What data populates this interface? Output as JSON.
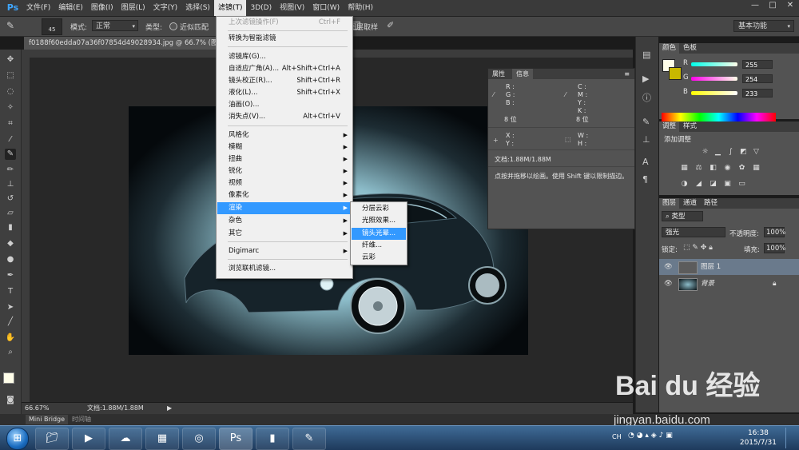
{
  "app": {
    "logo": "Ps",
    "menus": [
      "文件(F)",
      "编辑(E)",
      "图像(I)",
      "图层(L)",
      "文字(Y)",
      "选择(S)",
      "滤镜(T)",
      "3D(D)",
      "视图(V)",
      "窗口(W)",
      "帮助(H)"
    ],
    "active_menu": "滤镜(T)",
    "window_buttons": [
      "—",
      "□",
      "✕"
    ]
  },
  "options_bar": {
    "brush_size": "45",
    "mode_label": "模式:",
    "mode_value": "正常",
    "type_label": "类型:",
    "type_option": "近似匹配",
    "sample_label": "对所有图层取样",
    "workspace": "基本功能"
  },
  "document": {
    "tab_title": "f0188f60edda07a36f07854d49028934.jpg @ 66.7% (图层 1, RGB/8#) *",
    "zoom": "66.67%",
    "doc_size": "文档:1.88M/1.88M"
  },
  "filter_menu": {
    "items": [
      {
        "label": "上次滤镜操作(F)",
        "shortcut": "Ctrl+F",
        "disabled": true
      },
      {
        "label": "转换为智能滤镜"
      },
      {
        "label": "滤镜库(G)..."
      },
      {
        "label": "自适应广角(A)...",
        "shortcut": "Alt+Shift+Ctrl+A"
      },
      {
        "label": "镜头校正(R)...",
        "shortcut": "Shift+Ctrl+R"
      },
      {
        "label": "液化(L)...",
        "shortcut": "Shift+Ctrl+X"
      },
      {
        "label": "油画(O)..."
      },
      {
        "label": "消失点(V)...",
        "shortcut": "Alt+Ctrl+V"
      },
      {
        "label": "风格化",
        "submenu": true
      },
      {
        "label": "模糊",
        "submenu": true
      },
      {
        "label": "扭曲",
        "submenu": true
      },
      {
        "label": "锐化",
        "submenu": true
      },
      {
        "label": "视频",
        "submenu": true
      },
      {
        "label": "像素化",
        "submenu": true
      },
      {
        "label": "渲染",
        "submenu": true,
        "highlighted": true
      },
      {
        "label": "杂色",
        "submenu": true
      },
      {
        "label": "其它",
        "submenu": true
      },
      {
        "label": "Digimarc",
        "submenu": true
      },
      {
        "label": "浏览联机滤镜..."
      }
    ],
    "render_submenu": [
      "分层云彩",
      "光照效果...",
      "镜头光晕...",
      "纤维...",
      "云彩"
    ],
    "render_submenu_highlighted": "镜头光晕..."
  },
  "info_panel": {
    "tabs": [
      "属性",
      "信息"
    ],
    "active_tab": "信息",
    "rgb_labels": [
      "R :",
      "G :",
      "B :"
    ],
    "cmyk_labels": [
      "C :",
      "M :",
      "Y :",
      "K :"
    ],
    "bit_depth_left": "8 位",
    "bit_depth_right": "8 位",
    "xy_labels": [
      "X :",
      "Y :"
    ],
    "wh_labels": [
      "W :",
      "H :"
    ],
    "doc_line": "文档:1.88M/1.88M",
    "hint": "点按并拖移以绘画。使用 Shift 键以限制描边。"
  },
  "color_panel": {
    "tabs": [
      "颜色",
      "色板"
    ],
    "r": "255",
    "g": "254",
    "b": "233",
    "foreground": "#fffee9",
    "background": "#c9b800"
  },
  "adjust_panel": {
    "tabs": [
      "调整",
      "样式"
    ],
    "title": "添加调整"
  },
  "layers_panel": {
    "tabs": [
      "图层",
      "通道",
      "路径"
    ],
    "filter_label": "类型",
    "blend_mode": "强光",
    "opacity_label": "不透明度:",
    "opacity": "100%",
    "lock_label": "锁定:",
    "fill_label": "填充:",
    "fill": "100%",
    "layers": [
      {
        "name": "图层 1",
        "selected": true
      },
      {
        "name": "背景",
        "locked": true
      }
    ]
  },
  "bottom_tabs": [
    "Mini Bridge",
    "时间轴"
  ],
  "taskbar": {
    "time": "16:38",
    "date": "2015/7/31",
    "tray_lang": "CH"
  },
  "watermark": {
    "brand": "Bai du 经验",
    "url": "jingyan.baidu.com"
  }
}
